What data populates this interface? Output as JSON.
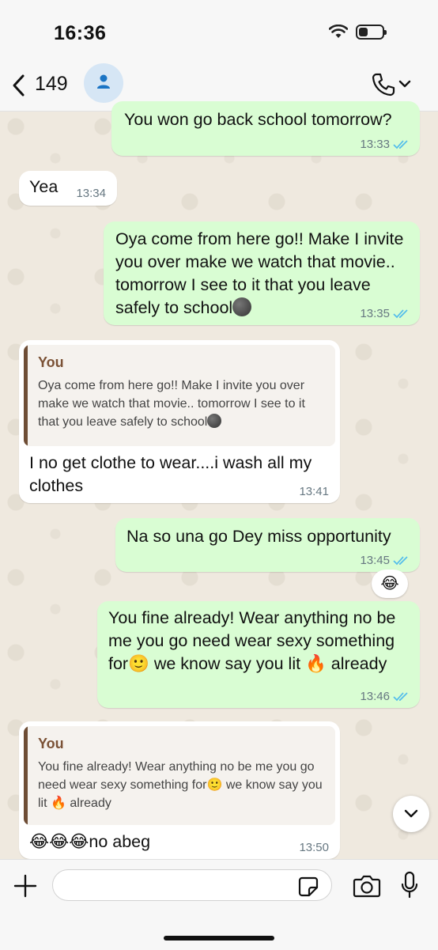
{
  "status_bar": {
    "time": "16:36"
  },
  "header": {
    "back_count": "149"
  },
  "messages": [
    {
      "direction": "out",
      "text": "You won go back school tomorrow?",
      "time": "13:33"
    },
    {
      "direction": "in",
      "text": "Yea",
      "time": "13:34"
    },
    {
      "direction": "out",
      "text": "Oya come from here go!! Make I invite you over make we watch that movie.. tomorrow I see to it that you leave safely to school",
      "time": "13:35"
    },
    {
      "direction": "in",
      "quote": {
        "author": "You",
        "text": "Oya come from here go!! Make I invite you over make we watch that movie.. tomorrow I see to it that you leave safely to school"
      },
      "text": "I no get clothe to wear....i wash all my clothes",
      "time": "13:41"
    },
    {
      "direction": "out",
      "text": "Na so una go Dey miss opportunity",
      "time": "13:45",
      "reaction": "😂"
    },
    {
      "direction": "out",
      "text_before": "You fine already! Wear anything no be me you go need wear sexy something for",
      "text_mid": " we know say you lit ",
      "text_after": " already",
      "time": "13:46"
    },
    {
      "direction": "in",
      "quote": {
        "author": "You",
        "text_before": "You fine already! Wear anything no be me you go need wear sexy something for",
        "text_mid": " we know say you lit ",
        "text_after": " already"
      },
      "emojis": "😂😂😂",
      "text": "no abeg",
      "time": "13:50"
    }
  ],
  "input": {
    "placeholder": ""
  },
  "colors": {
    "outgoing": "#d9fdd3",
    "incoming": "#ffffff",
    "tick_blue": "#53bdeb",
    "quote_bar": "#6e4d35"
  },
  "icons": [
    "back-chevron-icon",
    "avatar-person-icon",
    "phone-icon",
    "chevron-down-icon",
    "plus-icon",
    "sticker-icon",
    "camera-icon",
    "microphone-icon",
    "scroll-down-icon",
    "double-tick-icon"
  ]
}
